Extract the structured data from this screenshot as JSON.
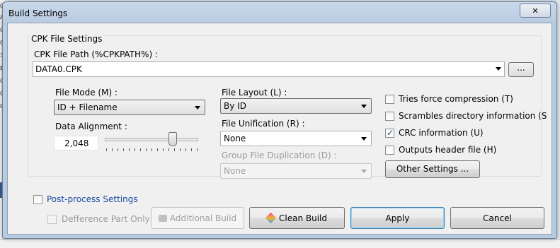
{
  "window": {
    "title": "Build Settings",
    "close_glyph": "✕"
  },
  "cpk_group": {
    "legend": "CPK File Settings"
  },
  "cpk_path": {
    "label": "CPK File Path (%CPKPATH%) :",
    "value": "DATA0.CPK",
    "browse_label": "..."
  },
  "file_mode": {
    "label": "File Mode (M) :",
    "value": "ID + Filename"
  },
  "data_alignment": {
    "label": "Data Alignment :",
    "value": "2,048"
  },
  "file_layout": {
    "label": "File Layout (L) :",
    "value": "By ID"
  },
  "file_unification": {
    "label": "File Unification (R) :",
    "value": "None"
  },
  "group_file_duplication": {
    "label": "Group File Duplication (D) :",
    "value": "None"
  },
  "options": {
    "tries_force_compression": {
      "label": "Tries force compression (T)",
      "checked": false
    },
    "scrambles_directory": {
      "label": "Scrambles directory information (S",
      "checked": false
    },
    "crc_information": {
      "label": "CRC information (U)",
      "checked": true
    },
    "outputs_header": {
      "label": "Outputs header file (H)",
      "checked": false
    }
  },
  "other_settings_button": "Other Settings ...",
  "post_process": {
    "label": "Post-process Settings",
    "checked": false
  },
  "difference_part_only": {
    "label": "Defference Part Only",
    "checked": false
  },
  "buttons": {
    "additional_build": "Additional Build",
    "clean_build": "Clean Build",
    "apply": "Apply",
    "cancel": "Cancel"
  },
  "check_glyph": "✓",
  "colors": {
    "title_bar": "#c9d8ea",
    "client_bg": "#f0f0f0",
    "link": "#1a4aa0",
    "default_button_border": "#3c7fb1"
  }
}
